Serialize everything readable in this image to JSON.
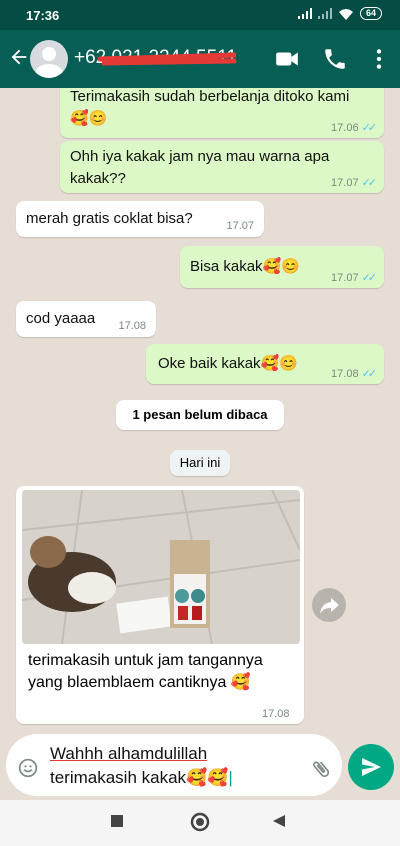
{
  "status": {
    "time": "17:36",
    "battery": "64"
  },
  "header": {
    "contact": "+62",
    "redacted": "021 2244 5511"
  },
  "messages": [
    {
      "dir": "out",
      "text": "Terimakasih sudah berbelanja ditoko kami",
      "emoji": "🥰😊",
      "time": "17.06"
    },
    {
      "dir": "out",
      "text": "Ohh iya kakak jam nya mau warna apa kakak??",
      "time": "17.07"
    },
    {
      "dir": "in",
      "text": "merah gratis coklat bisa?",
      "time": "17.07"
    },
    {
      "dir": "out",
      "text": "Bisa kakak",
      "emoji": "🥰😊",
      "time": "17.07"
    },
    {
      "dir": "in",
      "text": "cod yaaaa",
      "time": "17.08"
    },
    {
      "dir": "out",
      "text": "Oke baik kakak",
      "emoji": "🥰😊",
      "time": "17.08"
    }
  ],
  "unread_banner": "1 pesan belum dibaca",
  "date_chip": "Hari ini",
  "photo_message": {
    "caption_line1": "terimakasih untuk jam tangannya",
    "caption_line2": "yang blaemblaem cantiknya",
    "emoji": "🥰",
    "time": "17.08"
  },
  "composer": {
    "value_line1": "Wahhh alhamdulillah",
    "value_line2": "terimakasih kakak",
    "emoji": "🥰🥰"
  },
  "colors": {
    "header": "#075e54",
    "outgoing": "#dcf8c6",
    "send": "#00a884",
    "ticks": "#4fc3f7"
  }
}
